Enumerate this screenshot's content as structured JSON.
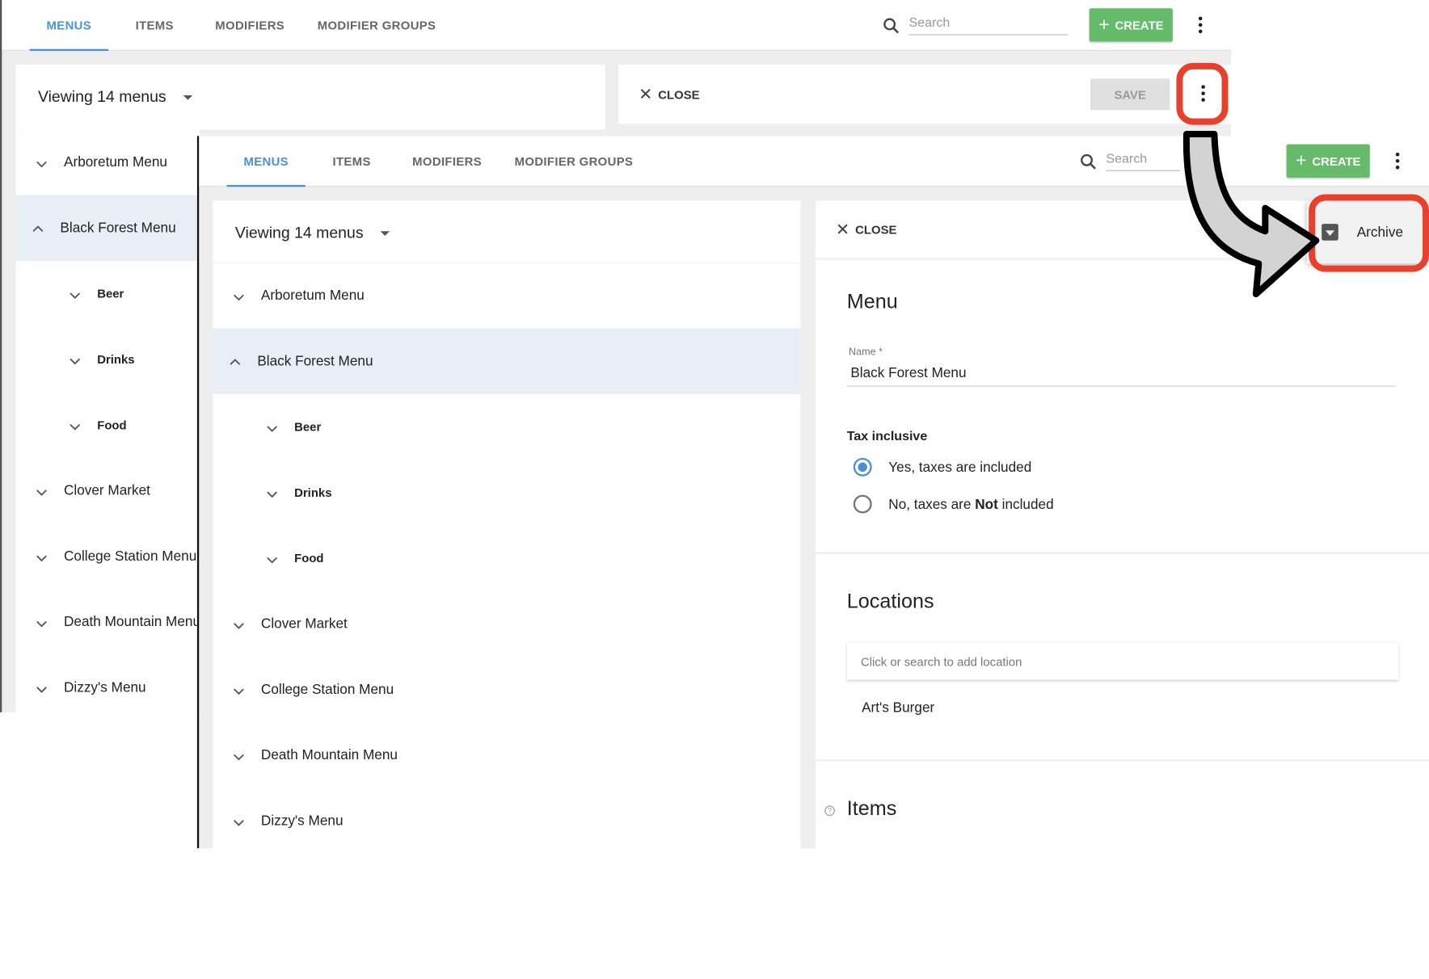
{
  "back": {
    "tabs": [
      "MENUS",
      "ITEMS",
      "MODIFIERS",
      "MODIFIER GROUPS"
    ],
    "search_placeholder": "Search",
    "create_label": "CREATE",
    "viewing": "Viewing 14 menus",
    "menus": [
      {
        "label": "Arboretum Menu",
        "expanded": false
      },
      {
        "label": "Black Forest Menu",
        "expanded": true,
        "selected": true
      },
      {
        "label": "Beer",
        "sub": true
      },
      {
        "label": "Drinks",
        "sub": true
      },
      {
        "label": "Food",
        "sub": true
      },
      {
        "label": "Clover Market",
        "expanded": false
      },
      {
        "label": "College Station Menu",
        "expanded": false
      },
      {
        "label": "Death Mountain Menu",
        "expanded": false
      },
      {
        "label": "Dizzy's Menu",
        "expanded": false
      }
    ],
    "close_label": "CLOSE",
    "save_label": "SAVE"
  },
  "front": {
    "tabs": [
      "MENUS",
      "ITEMS",
      "MODIFIERS",
      "MODIFIER GROUPS"
    ],
    "search_placeholder": "Search",
    "create_label": "CREATE",
    "viewing": "Viewing 14 menus",
    "menus": [
      {
        "label": "Arboretum Menu"
      },
      {
        "label": "Black Forest Menu",
        "selected": true
      },
      {
        "label": "Beer",
        "sub": true
      },
      {
        "label": "Drinks",
        "sub": true
      },
      {
        "label": "Food",
        "sub": true
      },
      {
        "label": "Clover Market"
      },
      {
        "label": "College Station Menu"
      },
      {
        "label": "Death Mountain Menu"
      },
      {
        "label": "Dizzy's Menu"
      }
    ],
    "close_label": "CLOSE",
    "detail": {
      "section_title": "Menu",
      "name_label": "Name *",
      "name_value": "Black Forest Menu",
      "tax_label": "Tax inclusive",
      "tax_yes": "Yes, taxes are included",
      "tax_no_prefix": "No, taxes are ",
      "tax_no_bold": "Not",
      "tax_no_suffix": " included",
      "locations_title": "Locations",
      "locations_placeholder": "Click or search to add location",
      "location_item": "Art's Burger",
      "items_title": "Items"
    },
    "archive_label": "Archive"
  },
  "colors": {
    "accent": "#4a90d9",
    "create_green": "#66bb6a",
    "highlight_red": "#e8412b",
    "selected_row": "#e8eef6"
  }
}
